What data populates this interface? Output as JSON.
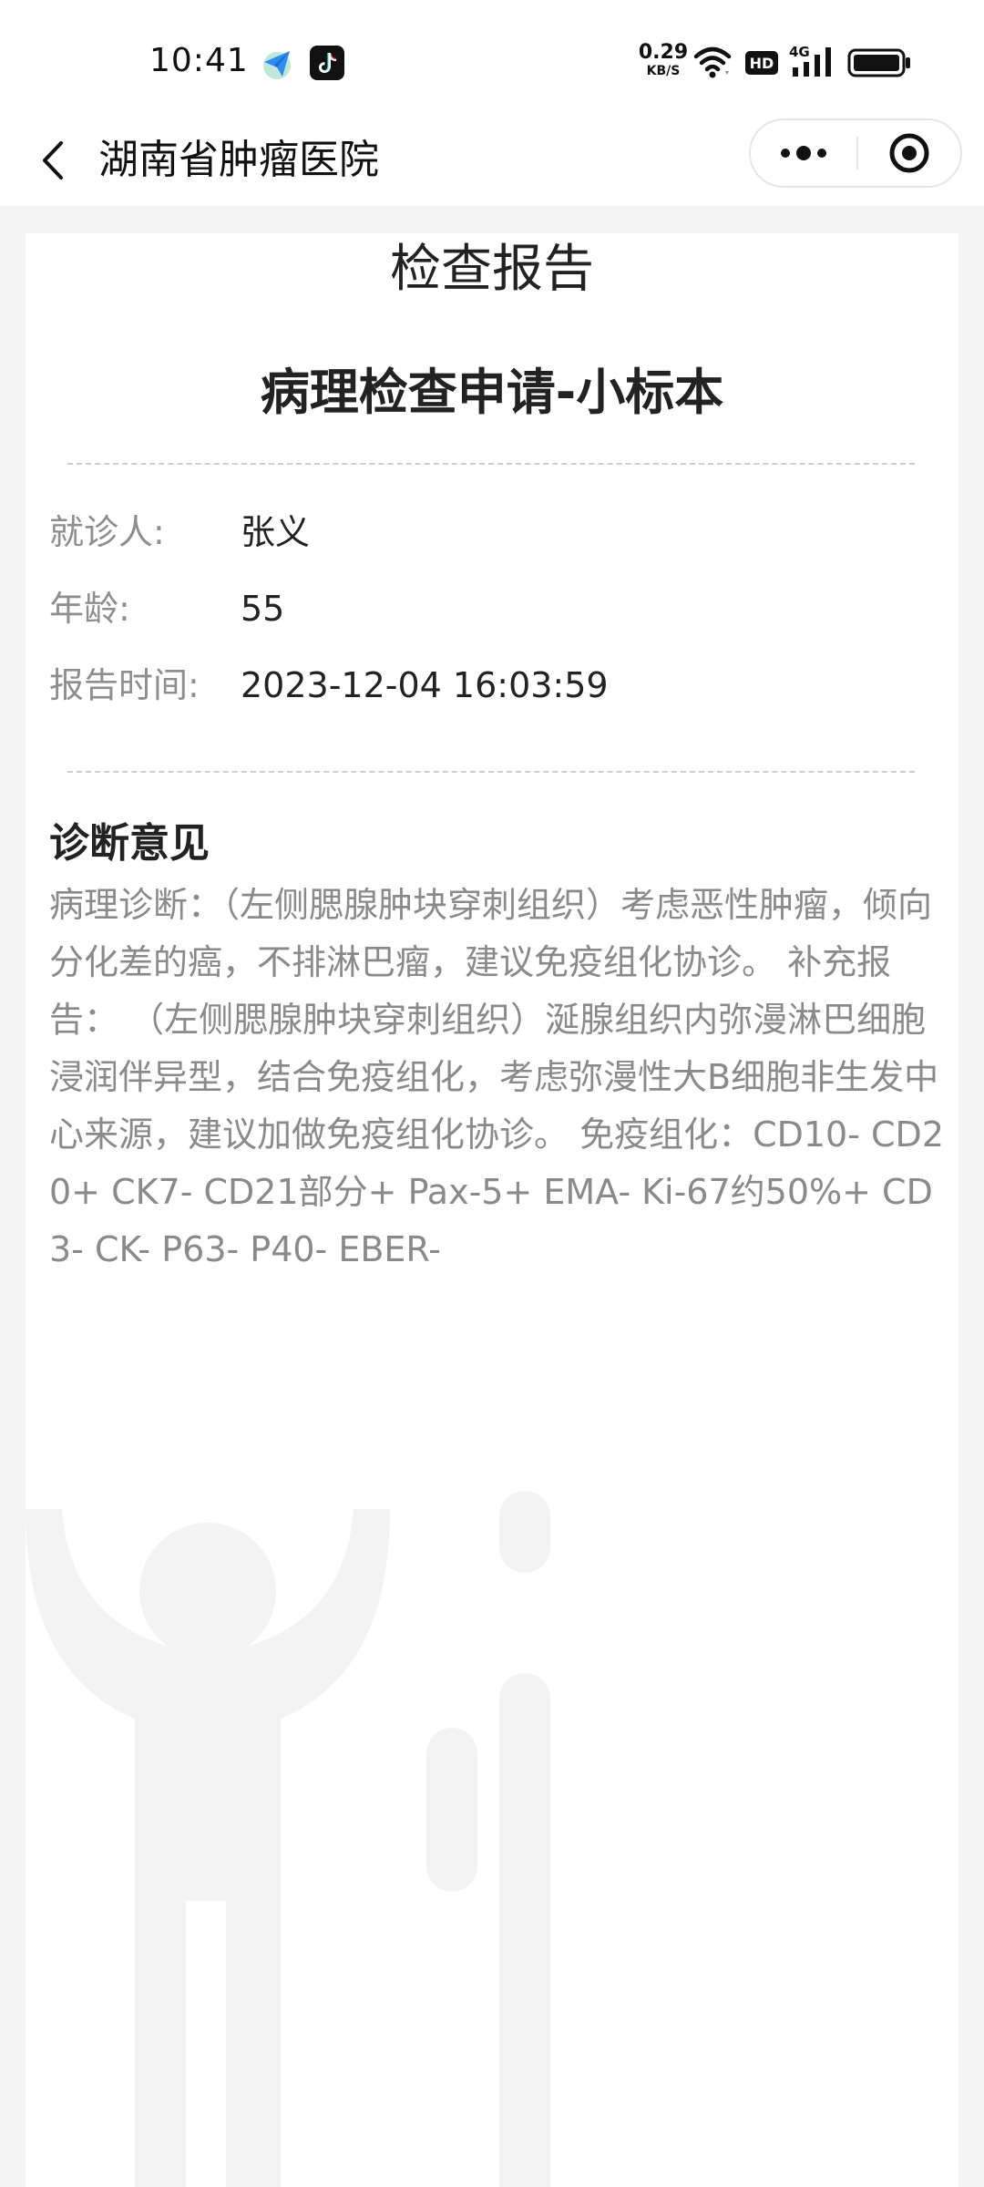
{
  "status_bar": {
    "time": "10:41",
    "net_speed_value": "0.29",
    "net_speed_unit": "KB/S",
    "hd_label": "HD",
    "network_label": "4G",
    "icons": [
      "send-app-icon",
      "tiktok-icon",
      "wifi-icon",
      "hd-icon",
      "signal-4g-icon",
      "battery-icon"
    ]
  },
  "nav": {
    "title": "湖南省肿瘤医院",
    "back_icon": "chevron-left-icon",
    "more_icon": "more-dots-icon",
    "close_icon": "target-circle-icon"
  },
  "report": {
    "heading": "检查报告",
    "title": "病理检查申请-小标本",
    "fields": [
      {
        "label": "就诊人:",
        "value": "张义"
      },
      {
        "label": "年龄:",
        "value": "55"
      },
      {
        "label": "报告时间:",
        "value": "2023-12-04 16:03:59"
      }
    ],
    "section_title": "诊断意见",
    "diagnosis": "病理诊断：（左侧腮腺肿块穿刺组织）考虑恶性肿瘤，倾向分化差的癌，不排淋巴瘤，建议免疫组化协诊。 补充报告：  （左侧腮腺肿块穿刺组织）涎腺组织内弥漫淋巴细胞浸润伴异型，结合免疫组化，考虑弥漫性大B细胞非生发中心来源，建议加做免疫组化协诊。 免疫组化：CD10- CD20+ CK7- CD21部分+ Pax-5+ EMA- Ki-67约50%+ CD3- CK- P63- P40- EBER-"
  },
  "colors": {
    "background": "#f4f4f4",
    "card": "#ffffff",
    "label_gray": "#8e8e8e",
    "text_dark": "#222222",
    "watermark": "#f3f3f3"
  }
}
